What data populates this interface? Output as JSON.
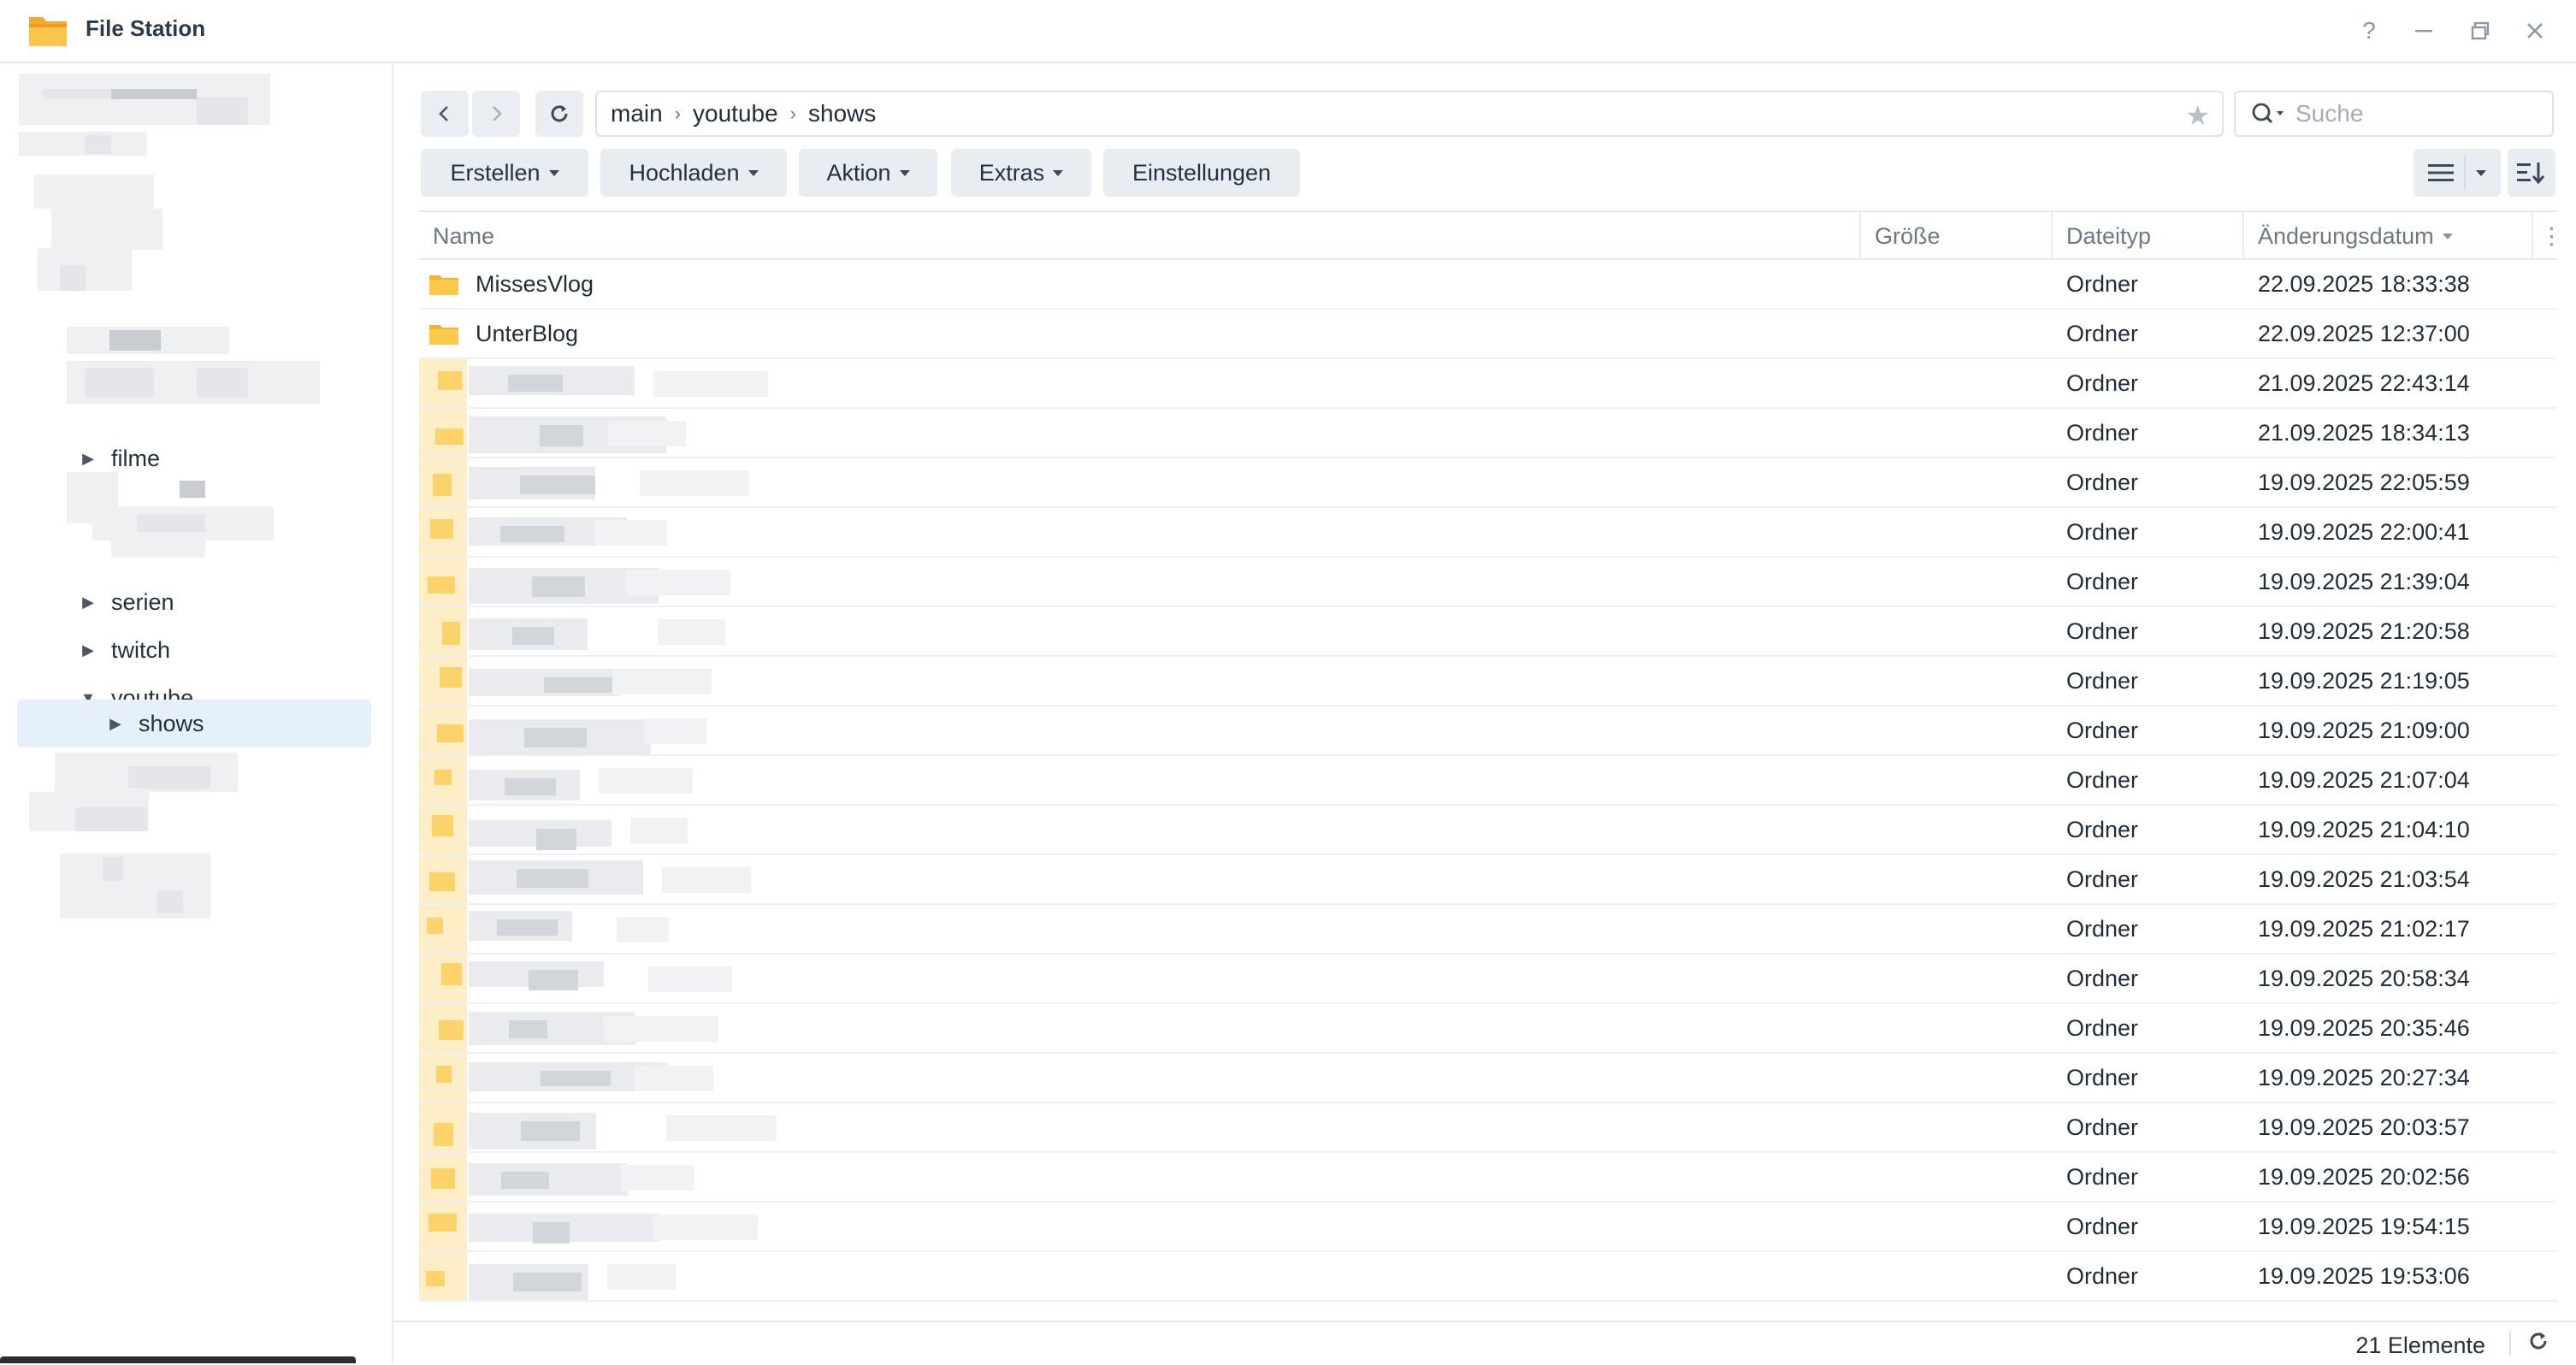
{
  "window": {
    "title": "File Station",
    "controls": [
      "help-icon",
      "minimize-icon",
      "restore-icon",
      "close-icon"
    ]
  },
  "sidebar": {
    "items": [
      {
        "label": "filme",
        "expanded": false
      },
      {
        "label": "serien",
        "expanded": false
      },
      {
        "label": "twitch",
        "expanded": false
      },
      {
        "label": "youtube",
        "expanded": true
      },
      {
        "label": "shows",
        "expanded": false,
        "selected": true
      }
    ]
  },
  "toolbar": {
    "path": [
      "main",
      "youtube",
      "shows"
    ],
    "search_placeholder": "Suche",
    "buttons": {
      "create": "Erstellen",
      "upload": "Hochladen",
      "action": "Aktion",
      "extras": "Extras",
      "settings": "Einstellungen"
    }
  },
  "table": {
    "columns": {
      "name": "Name",
      "size": "Größe",
      "type": "Dateityp",
      "modified": "Änderungsdatum"
    },
    "rows": [
      {
        "name": "MissesVlog",
        "size": "",
        "type": "Ordner",
        "modified": "22.09.2025 18:33:38"
      },
      {
        "name": "UnterBlog",
        "size": "",
        "type": "Ordner",
        "modified": "22.09.2025 12:37:00"
      },
      {
        "name": "",
        "size": "",
        "type": "Ordner",
        "modified": "21.09.2025 22:43:14"
      },
      {
        "name": "",
        "size": "",
        "type": "Ordner",
        "modified": "21.09.2025 18:34:13"
      },
      {
        "name": "",
        "size": "",
        "type": "Ordner",
        "modified": "19.09.2025 22:05:59"
      },
      {
        "name": "",
        "size": "",
        "type": "Ordner",
        "modified": "19.09.2025 22:00:41"
      },
      {
        "name": "",
        "size": "",
        "type": "Ordner",
        "modified": "19.09.2025 21:39:04"
      },
      {
        "name": "",
        "size": "",
        "type": "Ordner",
        "modified": "19.09.2025 21:20:58"
      },
      {
        "name": "",
        "size": "",
        "type": "Ordner",
        "modified": "19.09.2025 21:19:05"
      },
      {
        "name": "",
        "size": "",
        "type": "Ordner",
        "modified": "19.09.2025 21:09:00"
      },
      {
        "name": "",
        "size": "",
        "type": "Ordner",
        "modified": "19.09.2025 21:07:04"
      },
      {
        "name": "",
        "size": "",
        "type": "Ordner",
        "modified": "19.09.2025 21:04:10"
      },
      {
        "name": "",
        "size": "",
        "type": "Ordner",
        "modified": "19.09.2025 21:03:54"
      },
      {
        "name": "",
        "size": "",
        "type": "Ordner",
        "modified": "19.09.2025 21:02:17"
      },
      {
        "name": "",
        "size": "",
        "type": "Ordner",
        "modified": "19.09.2025 20:58:34"
      },
      {
        "name": "",
        "size": "",
        "type": "Ordner",
        "modified": "19.09.2025 20:35:46"
      },
      {
        "name": "",
        "size": "",
        "type": "Ordner",
        "modified": "19.09.2025 20:27:34"
      },
      {
        "name": "",
        "size": "",
        "type": "Ordner",
        "modified": "19.09.2025 20:03:57"
      },
      {
        "name": "",
        "size": "",
        "type": "Ordner",
        "modified": "19.09.2025 20:02:56"
      },
      {
        "name": "",
        "size": "",
        "type": "Ordner",
        "modified": "19.09.2025 19:54:15"
      },
      {
        "name": "",
        "size": "",
        "type": "Ordner",
        "modified": "19.09.2025 19:53:06"
      }
    ]
  },
  "footer": {
    "count_label": "21 Elemente"
  },
  "colors": {
    "accent_selected": "#e6f0fb",
    "folder": "#f9c23c",
    "button_bg": "#e8edf2"
  }
}
